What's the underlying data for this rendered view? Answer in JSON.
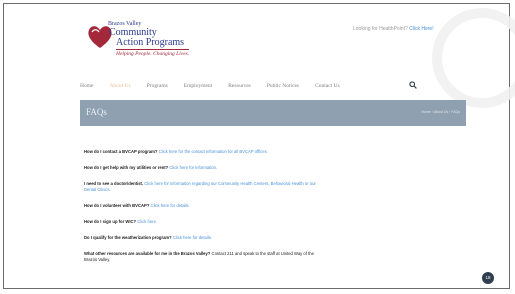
{
  "header": {
    "logo": {
      "top": "Brazos Valley",
      "line1": "Community",
      "line2": "Action Programs",
      "tagline": "Helping People. Changing Lives."
    },
    "looking_text": "Looking for HealthPoint?",
    "looking_link": "Click Here!"
  },
  "nav": {
    "items": [
      "Home",
      "About Us",
      "Programs",
      "Employment",
      "Resources",
      "Public Notices",
      "Contact Us"
    ],
    "active": "About Us",
    "search_icon": "search-icon"
  },
  "banner": {
    "title": "FAQs",
    "breadcrumb": "Home › About Us › FAQs"
  },
  "faqs": [
    {
      "q": "How do I contact a BVCAP program?",
      "link": "Click here for the contact information for all BVCAP offices.",
      "rest": ""
    },
    {
      "q": "How do I get help with my utilities or rent?",
      "link": "Click here for information.",
      "rest": ""
    },
    {
      "q": "I need to see a doctor/dentist.",
      "link": "Click here for information regarding our Community Health Centers, Behavioral Health or our Dental Clinics.",
      "rest": ""
    },
    {
      "q": "How do I volunteer with BVCAP?",
      "link": "Click here for details.",
      "rest": ""
    },
    {
      "q": "How do I sign up for WIC?",
      "link": "Click here.",
      "rest": ""
    },
    {
      "q": "Do I qualify for the weatherization program?",
      "link": "Click here for details.",
      "rest": ""
    },
    {
      "q": "What other resources are available for me in the Brazos Valley?",
      "link": "",
      "rest": "Contact 211 and speak to the staff at United Way of the Brazos Valley."
    }
  ],
  "slide_number": "18",
  "colors": {
    "logo_blue": "#2b3a8c",
    "logo_red": "#a3283a",
    "link": "#4a90d9",
    "banner": "#8fa0b0",
    "nav_active": "#f0c090"
  }
}
